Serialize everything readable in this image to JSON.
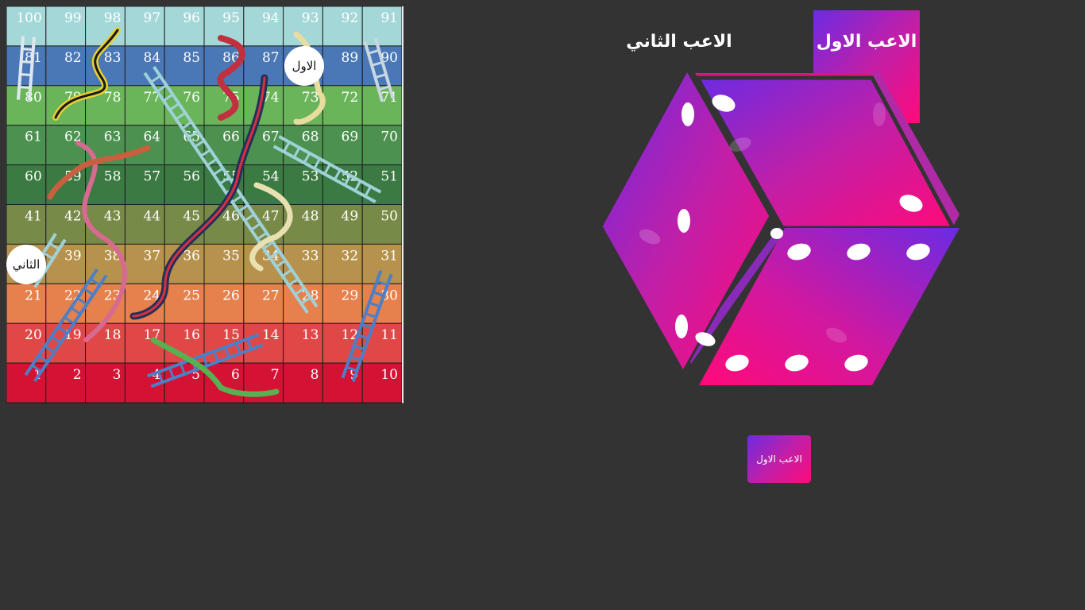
{
  "board": {
    "rows": [
      {
        "color": "#a4d8d8",
        "cells": [
          "100",
          "99",
          "98",
          "97",
          "96",
          "95",
          "94",
          "93",
          "92",
          "91"
        ]
      },
      {
        "color": "#4a77b6",
        "cells": [
          "81",
          "82",
          "83",
          "84",
          "85",
          "86",
          "87",
          "88",
          "89",
          "90"
        ]
      },
      {
        "color": "#6ab55a",
        "cells": [
          "80",
          "79",
          "78",
          "77",
          "76",
          "75",
          "74",
          "73",
          "72",
          "71"
        ]
      },
      {
        "color": "#4d9150",
        "cells": [
          "61",
          "62",
          "63",
          "64",
          "65",
          "66",
          "67",
          "68",
          "69",
          "70"
        ]
      },
      {
        "color": "#3b7a42",
        "cells": [
          "60",
          "59",
          "58",
          "57",
          "56",
          "55",
          "54",
          "53",
          "52",
          "51"
        ]
      },
      {
        "color": "#788a48",
        "cells": [
          "41",
          "42",
          "43",
          "44",
          "45",
          "46",
          "47",
          "48",
          "49",
          "50"
        ]
      },
      {
        "color": "#b7924c",
        "cells": [
          "40",
          "39",
          "38",
          "37",
          "36",
          "35",
          "34",
          "33",
          "32",
          "31"
        ]
      },
      {
        "color": "#e6804c",
        "cells": [
          "21",
          "22",
          "23",
          "24",
          "25",
          "26",
          "27",
          "28",
          "29",
          "30"
        ]
      },
      {
        "color": "#e04848",
        "cells": [
          "20",
          "19",
          "18",
          "17",
          "16",
          "15",
          "14",
          "13",
          "12",
          "11"
        ]
      },
      {
        "color": "#d41234",
        "cells": [
          "1",
          "2",
          "3",
          "4",
          "5",
          "6",
          "7",
          "8",
          "9",
          "10"
        ]
      }
    ]
  },
  "tokens": {
    "player1": "الاول",
    "player2": "الثاني"
  },
  "players": {
    "player1_name": "الاعب الاول",
    "player2_name": "الاعب الثاني"
  },
  "turn_button": "الاعب الاول",
  "colors": {
    "background": "#333333",
    "gradient_start": "#6b2be3",
    "gradient_end": "#ff0a7a"
  }
}
